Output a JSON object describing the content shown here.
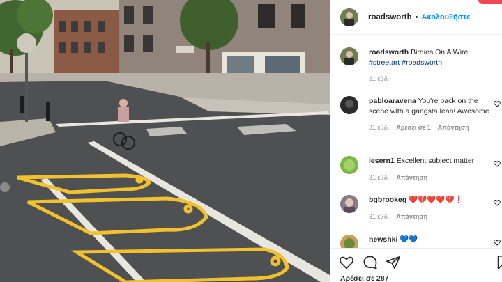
{
  "post": {
    "username": "roadsworth",
    "follow_label": "Ακολουθήστε",
    "dot": "•",
    "caption_text": "Birdies On A Wire",
    "hashtags": "#streetart #roadsworth",
    "caption_time": "31 εβδ."
  },
  "comments": [
    {
      "username": "pabloaravena",
      "text": "You're back on the scene with a gangsta lean! Awesome",
      "time": "31 εβδ.",
      "likes": "Αρέσει σε 1",
      "reply": "Απάντηση"
    },
    {
      "username": "lesern1",
      "text": "Excellent subject matter",
      "time": "31 εβδ.",
      "reply": "Απάντηση"
    },
    {
      "username": "bgbrookeg",
      "text": "❤️💔❤️❤️💔❗",
      "time": "31 εβδ.",
      "reply": "Απάντηση"
    },
    {
      "username": "newshki",
      "text": "💙💙"
    }
  ],
  "actions": {
    "icons": [
      "heart-icon",
      "comment-icon",
      "share-icon",
      "bookmark-icon"
    ],
    "likes_text": "Αρέσει σε 287"
  },
  "colors": {
    "link": "#0095f6",
    "hashtag": "#00376b",
    "muted": "#8e8e8e",
    "road_paint": "#f2c12e"
  }
}
